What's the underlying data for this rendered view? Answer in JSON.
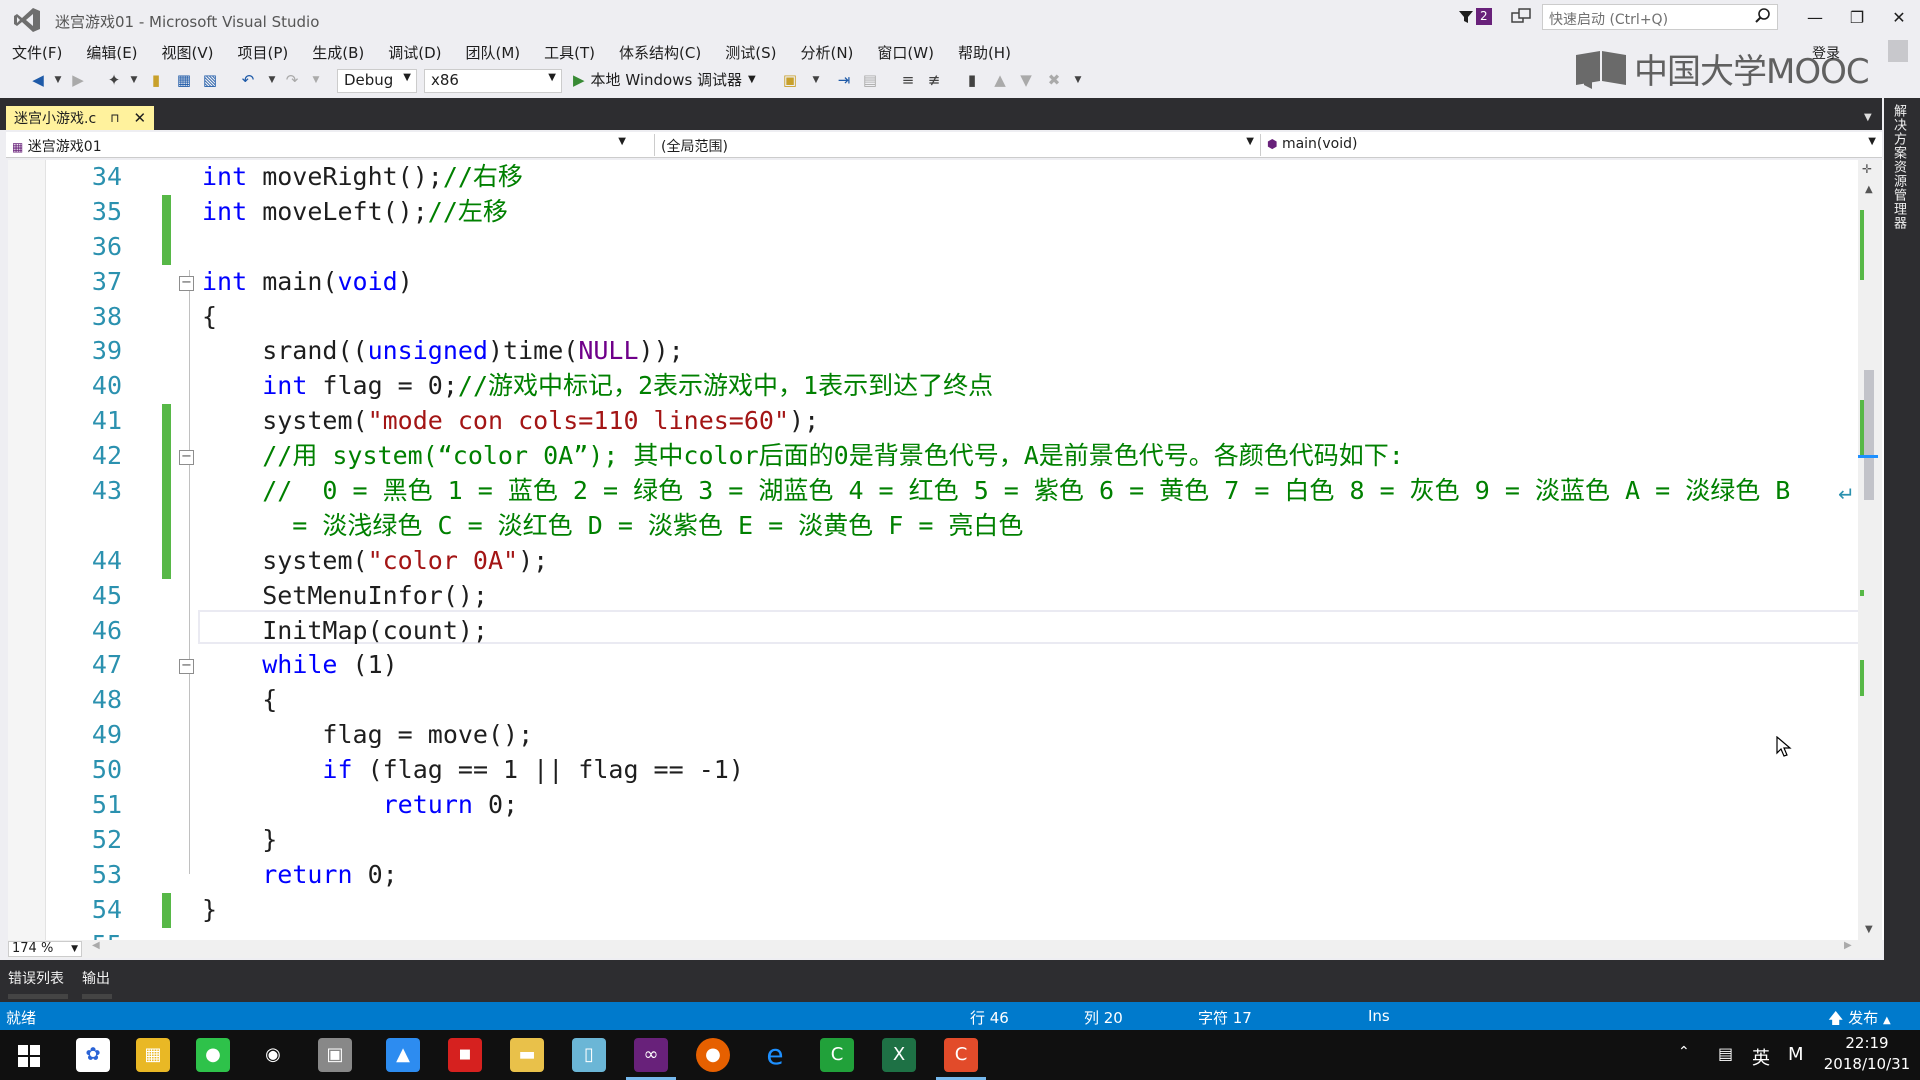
{
  "window": {
    "title": "迷宫游戏01 - Microsoft Visual Studio",
    "notification_count": "2",
    "quick_launch_placeholder": "快速启动 (Ctrl+Q)",
    "login": "登录",
    "watermark": "中国大学MOOC"
  },
  "menu": [
    "文件(F)",
    "编辑(E)",
    "视图(V)",
    "项目(P)",
    "生成(B)",
    "调试(D)",
    "团队(M)",
    "工具(T)",
    "体系结构(C)",
    "测试(S)",
    "分析(N)",
    "窗口(W)",
    "帮助(H)"
  ],
  "toolbar": {
    "config": "Debug",
    "platform": "x86",
    "run_label": "本地 Windows 调试器"
  },
  "doc_tab": {
    "label": "迷宫小游戏.c",
    "pin": "⊓",
    "close": "✕"
  },
  "navbar": {
    "project": "迷宫游戏01",
    "scope": "(全局范围)",
    "member": "main(void)"
  },
  "code_lines": [
    {
      "num": "34",
      "tokens": [
        [
          "kw",
          "int"
        ],
        [
          "t",
          " moveRight();"
        ],
        [
          "cm",
          "//右移"
        ]
      ]
    },
    {
      "num": "35",
      "tokens": [
        [
          "kw",
          "int"
        ],
        [
          "t",
          " moveLeft();"
        ],
        [
          "cm",
          "//左移"
        ]
      ]
    },
    {
      "num": "36",
      "tokens": []
    },
    {
      "num": "37",
      "tokens": [
        [
          "kw",
          "int"
        ],
        [
          "t",
          " main("
        ],
        [
          "kw",
          "void"
        ],
        [
          "t",
          ")"
        ]
      ]
    },
    {
      "num": "38",
      "tokens": [
        [
          "t",
          "{"
        ]
      ]
    },
    {
      "num": "39",
      "tokens": [
        [
          "t",
          "    srand(("
        ],
        [
          "kw",
          "unsigned"
        ],
        [
          "t",
          ")time("
        ],
        [
          "mc",
          "NULL"
        ],
        [
          "t",
          "));"
        ]
      ]
    },
    {
      "num": "40",
      "tokens": [
        [
          "t",
          "    "
        ],
        [
          "kw",
          "int"
        ],
        [
          "t",
          " flag = 0;"
        ],
        [
          "cm",
          "//游戏中标记，2表示游戏中，1表示到达了终点"
        ]
      ]
    },
    {
      "num": "41",
      "tokens": [
        [
          "t",
          "    system("
        ],
        [
          "st",
          "\"mode con cols=110 lines=60\""
        ],
        [
          "t",
          ");"
        ]
      ]
    },
    {
      "num": "42",
      "tokens": [
        [
          "t",
          "    "
        ],
        [
          "cm",
          "//用 system(“color 0A”); 其中color后面的0是背景色代号，A是前景色代号。各颜色代码如下:"
        ]
      ]
    },
    {
      "num": "43",
      "tokens": [
        [
          "t",
          "    "
        ],
        [
          "cm",
          "//  0 = 黑色 1 = 蓝色 2 = 绿色 3 = 湖蓝色 4 = 红色 5 = 紫色 6 = 黄色 7 = 白色 8 = 灰色 9 = 淡蓝色 A = 淡绿色 B"
        ]
      ]
    },
    {
      "num": "",
      "tokens": [
        [
          "cm",
          "      = 淡浅绿色 C = 淡红色 D = 淡紫色 E = 淡黄色 F = 亮白色"
        ]
      ]
    },
    {
      "num": "44",
      "tokens": [
        [
          "t",
          "    system("
        ],
        [
          "st",
          "\"color 0A\""
        ],
        [
          "t",
          ");"
        ]
      ]
    },
    {
      "num": "45",
      "tokens": [
        [
          "t",
          "    SetMenuInfor();"
        ]
      ]
    },
    {
      "num": "46",
      "tokens": [
        [
          "t",
          "    InitMap(count);"
        ]
      ]
    },
    {
      "num": "47",
      "tokens": [
        [
          "t",
          "    "
        ],
        [
          "kw",
          "while"
        ],
        [
          "t",
          " (1)"
        ]
      ]
    },
    {
      "num": "48",
      "tokens": [
        [
          "t",
          "    {"
        ]
      ]
    },
    {
      "num": "49",
      "tokens": [
        [
          "t",
          "        flag = move();"
        ]
      ]
    },
    {
      "num": "50",
      "tokens": [
        [
          "t",
          "        "
        ],
        [
          "kw",
          "if"
        ],
        [
          "t",
          " (flag == 1 || flag == -1)"
        ]
      ]
    },
    {
      "num": "51",
      "tokens": [
        [
          "t",
          "            "
        ],
        [
          "kw",
          "return"
        ],
        [
          "t",
          " 0;"
        ]
      ]
    },
    {
      "num": "52",
      "tokens": [
        [
          "t",
          "    }"
        ]
      ]
    },
    {
      "num": "53",
      "tokens": [
        [
          "t",
          "    "
        ],
        [
          "kw",
          "return"
        ],
        [
          "t",
          " 0;"
        ]
      ]
    },
    {
      "num": "54",
      "tokens": [
        [
          "t",
          "}"
        ]
      ]
    },
    {
      "num": "55",
      "tokens": []
    }
  ],
  "zoom": "174 %",
  "side_panel_label": "解决方案资源管理器",
  "tool_tabs": [
    "错误列表",
    "输出"
  ],
  "status": {
    "ready": "就绪",
    "line": "行 46",
    "col": "列 20",
    "ch": "字符 17",
    "mode": "Ins",
    "publish": "发布"
  },
  "clock": {
    "time": "22:19",
    "date": "2018/10/31"
  },
  "tray": {
    "ime": "英",
    "ime2": "M"
  },
  "colors": {
    "keyword": "#0000ff",
    "comment": "#008000",
    "string": "#a31515",
    "macro": "#6f008a",
    "line_number": "#2b91af",
    "status_bar": "#007acc",
    "change_marker": "#57b847",
    "active_tab": "#fff29d"
  }
}
